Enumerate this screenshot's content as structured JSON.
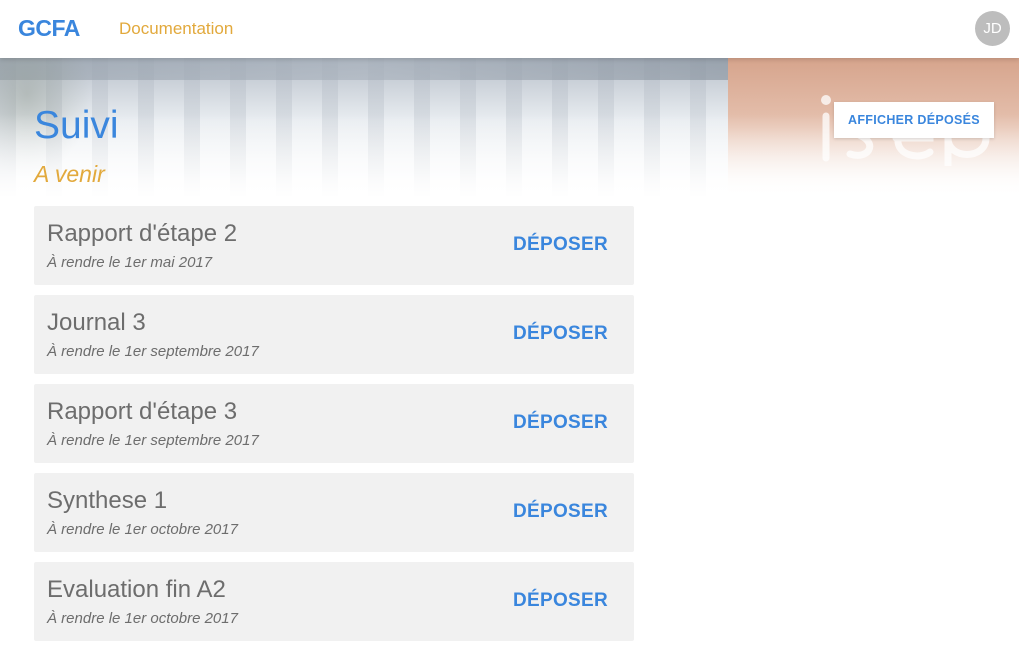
{
  "header": {
    "brand": "GCFA",
    "brand_color": "#3a86dd",
    "nav_link": "Documentation",
    "nav_link_color": "#e2a93c",
    "avatar_initials": "JD"
  },
  "hero": {
    "logo_text": "isep"
  },
  "page": {
    "title": "Suivi",
    "section_title": "A venir",
    "show_deposited_label": "AFFICHER DÉPOSÉS"
  },
  "assignments": [
    {
      "title": "Rapport d'étape 2",
      "due": "À rendre le 1er mai 2017",
      "action": "DÉPOSER"
    },
    {
      "title": "Journal 3",
      "due": "À rendre le 1er septembre 2017",
      "action": "DÉPOSER"
    },
    {
      "title": "Rapport d'étape 3",
      "due": "À rendre le 1er septembre 2017",
      "action": "DÉPOSER"
    },
    {
      "title": "Synthese 1",
      "due": "À rendre le 1er octobre 2017",
      "action": "DÉPOSER"
    },
    {
      "title": "Evaluation fin A2",
      "due": "À rendre le 1er octobre 2017",
      "action": "DÉPOSER"
    }
  ]
}
